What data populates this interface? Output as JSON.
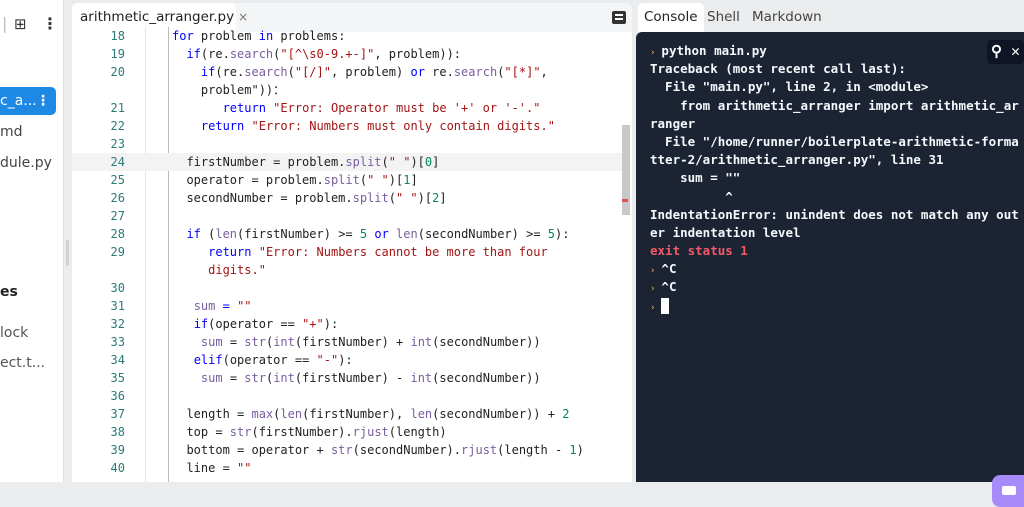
{
  "sidebar": {
    "items": [
      {
        "label": "c_a..."
      },
      {
        "label": "md"
      },
      {
        "label": "dule.py"
      }
    ],
    "section_heading": "es",
    "items2": [
      {
        "label": "lock"
      },
      {
        "label": "ect.t..."
      }
    ]
  },
  "editor": {
    "tab_label": "arithmetic_arranger.py",
    "tab_close": "×",
    "lines": [
      {
        "n": "18",
        "t": [
          [
            "",
            "for",
            ""
          ],
          [
            "",
            " problem "
          ],
          [
            "k",
            "in"
          ],
          [
            "",
            " problems:"
          ]
        ]
      },
      {
        "n": "19",
        "t": [
          [
            "",
            "  "
          ],
          [
            "k",
            "if"
          ],
          [
            "",
            "(re."
          ],
          [
            "f",
            "search"
          ],
          [
            "",
            "("
          ],
          [
            "s",
            "\"[^\\s0-9.+-]\""
          ],
          [
            "",
            ", problem)):"
          ]
        ]
      },
      {
        "n": "20",
        "t": [
          [
            "",
            "    "
          ],
          [
            "k",
            "if"
          ],
          [
            "",
            "(re."
          ],
          [
            "f",
            "search"
          ],
          [
            "",
            "("
          ],
          [
            "s",
            "\"[/]\""
          ],
          [
            "",
            ", problem) "
          ],
          [
            "k",
            "or"
          ],
          [
            "",
            " re."
          ],
          [
            "f",
            "search"
          ],
          [
            "",
            "("
          ],
          [
            "s",
            "\"[*]\""
          ],
          [
            "",
            ","
          ]
        ]
      },
      {
        "n": "",
        "t": [
          [
            "",
            "    problem\"))："
          ]
        ]
      },
      {
        "n": "21",
        "t": [
          [
            "",
            "       "
          ],
          [
            "k",
            "return"
          ],
          [
            "",
            " "
          ],
          [
            "s",
            "\"Error: Operator must be '+' or '-'.\""
          ]
        ]
      },
      {
        "n": "22",
        "t": [
          [
            "",
            "    "
          ],
          [
            "k",
            "return"
          ],
          [
            "",
            " "
          ],
          [
            "s",
            "\"Error: Numbers must only contain digits.\""
          ]
        ]
      },
      {
        "n": "23",
        "t": []
      },
      {
        "n": "24",
        "cur": true,
        "t": [
          [
            "",
            "  firstNumber = problem."
          ],
          [
            "f",
            "split"
          ],
          [
            "",
            "("
          ],
          [
            "s",
            "\" \""
          ],
          [
            "",
            ")["
          ],
          [
            "n",
            "0"
          ],
          [
            "",
            "]"
          ]
        ]
      },
      {
        "n": "25",
        "t": [
          [
            "",
            "  operator = problem."
          ],
          [
            "f",
            "split"
          ],
          [
            "",
            "("
          ],
          [
            "s",
            "\" \""
          ],
          [
            "",
            ")["
          ],
          [
            "n",
            "1"
          ],
          [
            "",
            "]"
          ]
        ]
      },
      {
        "n": "26",
        "t": [
          [
            "",
            "  secondNumber = problem."
          ],
          [
            "f",
            "split"
          ],
          [
            "",
            "("
          ],
          [
            "s",
            "\" \""
          ],
          [
            "",
            ")["
          ],
          [
            "n",
            "2"
          ],
          [
            "",
            "]"
          ]
        ]
      },
      {
        "n": "27",
        "t": []
      },
      {
        "n": "28",
        "t": [
          [
            "",
            "  "
          ],
          [
            "k",
            "if"
          ],
          [
            "",
            " ("
          ],
          [
            "f",
            "len"
          ],
          [
            "",
            "(firstNumber) >= "
          ],
          [
            "n",
            "5"
          ],
          [
            "",
            " "
          ],
          [
            "k",
            "or"
          ],
          [
            "",
            " "
          ],
          [
            "f",
            "len"
          ],
          [
            "",
            "(secondNumber) >= "
          ],
          [
            "n",
            "5"
          ],
          [
            "",
            "):"
          ]
        ]
      },
      {
        "n": "29",
        "t": [
          [
            "",
            "     "
          ],
          [
            "k",
            "return"
          ],
          [
            "",
            " "
          ],
          [
            "s",
            "\"Error: Numbers cannot be more than four"
          ]
        ]
      },
      {
        "n": "",
        "t": [
          [
            "",
            "     "
          ],
          [
            "s",
            "digits.\""
          ]
        ]
      },
      {
        "n": "30",
        "t": []
      },
      {
        "n": "31",
        "t": [
          [
            "",
            "   "
          ],
          [
            "f",
            "sum"
          ],
          [
            "k",
            " = "
          ],
          [
            "s",
            "\"\""
          ]
        ]
      },
      {
        "n": "32",
        "t": [
          [
            "",
            "   "
          ],
          [
            "k",
            "if"
          ],
          [
            "",
            "(operator == "
          ],
          [
            "s",
            "\"+\""
          ],
          [
            "",
            "):"
          ]
        ]
      },
      {
        "n": "33",
        "t": [
          [
            "",
            "    "
          ],
          [
            "f",
            "sum"
          ],
          [
            "",
            " = "
          ],
          [
            "f",
            "str"
          ],
          [
            "",
            "("
          ],
          [
            "f",
            "int"
          ],
          [
            "",
            "(firstNumber) + "
          ],
          [
            "f",
            "int"
          ],
          [
            "",
            "(secondNumber))"
          ]
        ]
      },
      {
        "n": "34",
        "t": [
          [
            "",
            "   "
          ],
          [
            "k",
            "elif"
          ],
          [
            "",
            "(operator == "
          ],
          [
            "s",
            "\"-\""
          ],
          [
            "",
            "):"
          ]
        ]
      },
      {
        "n": "35",
        "t": [
          [
            "",
            "    "
          ],
          [
            "f",
            "sum"
          ],
          [
            "",
            " = "
          ],
          [
            "f",
            "str"
          ],
          [
            "",
            "("
          ],
          [
            "f",
            "int"
          ],
          [
            "",
            "(firstNumber) - "
          ],
          [
            "f",
            "int"
          ],
          [
            "",
            "(secondNumber))"
          ]
        ]
      },
      {
        "n": "36",
        "t": []
      },
      {
        "n": "37",
        "t": [
          [
            "",
            "  length = "
          ],
          [
            "f",
            "max"
          ],
          [
            "",
            "("
          ],
          [
            "f",
            "len"
          ],
          [
            "",
            "(firstNumber), "
          ],
          [
            "f",
            "len"
          ],
          [
            "",
            "(secondNumber)) + "
          ],
          [
            "n",
            "2"
          ]
        ]
      },
      {
        "n": "38",
        "t": [
          [
            "",
            "  top = "
          ],
          [
            "f",
            "str"
          ],
          [
            "",
            "(firstNumber)."
          ],
          [
            "f",
            "rjust"
          ],
          [
            "",
            "(length)"
          ]
        ]
      },
      {
        "n": "39",
        "t": [
          [
            "",
            "  bottom = operator + "
          ],
          [
            "f",
            "str"
          ],
          [
            "",
            "(secondNumber)."
          ],
          [
            "f",
            "rjust"
          ],
          [
            "",
            "(length - "
          ],
          [
            "n",
            "1"
          ],
          [
            "",
            ")"
          ]
        ]
      },
      {
        "n": "40",
        "t": [
          [
            "",
            "  line = "
          ],
          [
            "s",
            "\"\""
          ]
        ]
      }
    ]
  },
  "right": {
    "tabs": [
      {
        "label": "Console"
      },
      {
        "label": "Shell"
      },
      {
        "label": "Markdown"
      }
    ],
    "search_icon": "⚲",
    "close_icon": "✕",
    "console_lines": [
      {
        "p": true,
        "text": "python main.py"
      },
      {
        "text": "Traceback (most recent call last):"
      },
      {
        "text": "  File \"main.py\", line 2, in <module>"
      },
      {
        "text": "    from arithmetic_arranger import arithmetic_ar"
      },
      {
        "text": "ranger"
      },
      {
        "text": "  File \"/home/runner/boilerplate-arithmetic-forma"
      },
      {
        "text": "tter-2/arithmetic_arranger.py\", line 31"
      },
      {
        "text": "    sum = \"\""
      },
      {
        "text": "          ^"
      },
      {
        "text": "IndentationError: unindent does not match any out"
      },
      {
        "text": "er indentation level"
      },
      {
        "err": true,
        "text": "exit status 1"
      },
      {
        "p": true,
        "text": "^C"
      },
      {
        "p": true,
        "text": "^C"
      },
      {
        "p": true,
        "cursor": true,
        "text": ""
      }
    ]
  }
}
